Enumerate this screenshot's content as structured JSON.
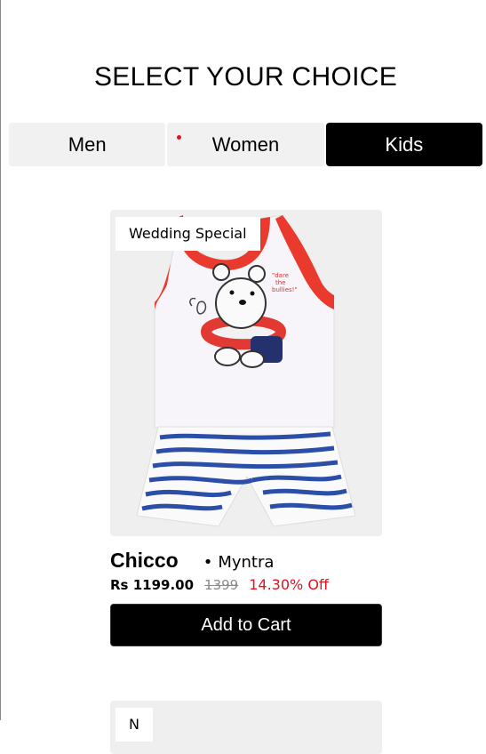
{
  "page": {
    "title": "SELECT YOUR CHOICE"
  },
  "tabs": [
    {
      "label": "Men",
      "active": false
    },
    {
      "label": "Women",
      "active": false
    },
    {
      "label": "Kids",
      "active": true
    }
  ],
  "products": [
    {
      "badge": "Wedding Special",
      "brand": "Chicco",
      "seller": "Myntra",
      "price": "Rs 1199.00",
      "mrp": "1399",
      "discount": "14.30% Off",
      "cta": "Add to Cart",
      "image_icon": "kids-tank-top-and-striped-shorts-image"
    },
    {
      "badge": "N",
      "image_icon": "product-image"
    }
  ],
  "colors": {
    "accent_red": "#e0121e",
    "active_tab_bg": "#000000",
    "inactive_tab_bg": "#f1f1f1",
    "card_bg": "#efefef"
  }
}
